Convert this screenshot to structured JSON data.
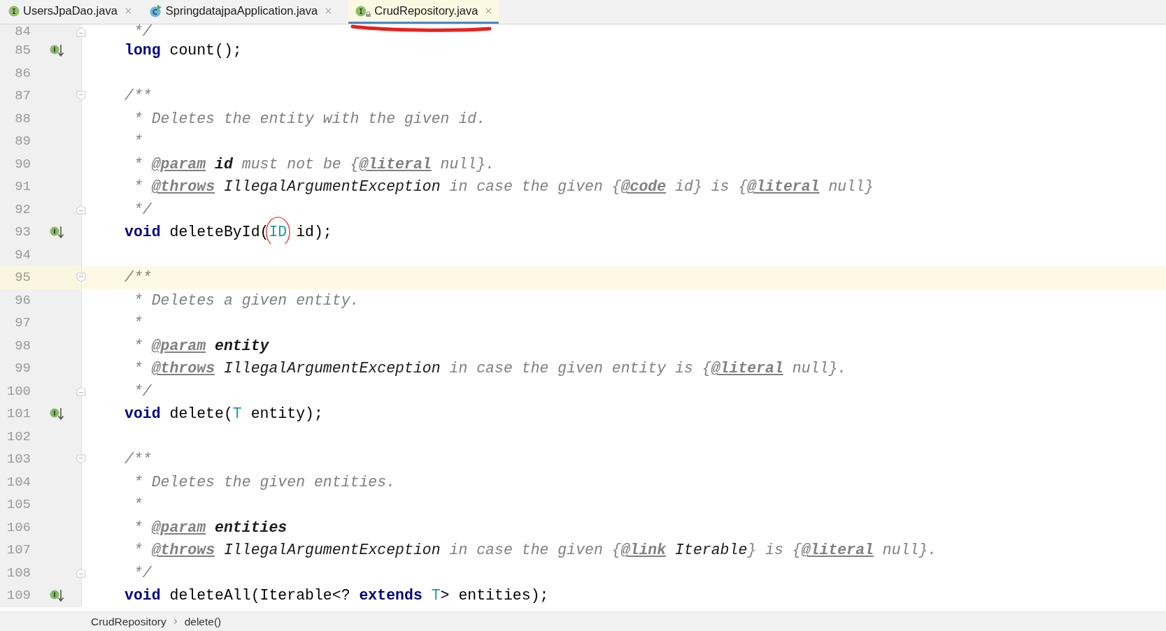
{
  "tabs": [
    {
      "label": "UsersJpaDao.java",
      "kind": "interface",
      "selected": false,
      "annotated": false
    },
    {
      "label": "SpringdatajpaApplication.java",
      "kind": "runnable-class",
      "selected": false,
      "annotated": false
    },
    {
      "label": "CrudRepository.java",
      "kind": "locked-interface",
      "selected": true,
      "annotated": true
    }
  ],
  "editor": {
    "lines": [
      {
        "number": "84",
        "kind": "fold-end",
        "current": false,
        "tokens": [
          {
            "kind": "comment",
            "text": " */"
          }
        ]
      },
      {
        "number": "85",
        "kind": "implemented",
        "current": false,
        "tokens": [
          {
            "kind": "keyword",
            "text": "long"
          },
          {
            "kind": "plain",
            "text": " count();"
          }
        ]
      },
      {
        "number": "86",
        "kind": "plain",
        "current": false
      },
      {
        "number": "87",
        "kind": "fold-start",
        "current": false,
        "tokens": [
          {
            "kind": "comment",
            "text": "/**"
          }
        ]
      },
      {
        "number": "88",
        "kind": "plain",
        "current": false,
        "tokens": [
          {
            "kind": "comment",
            "text": " * Deletes the entity with the given id."
          }
        ]
      },
      {
        "number": "89",
        "kind": "plain",
        "current": false,
        "tokens": [
          {
            "kind": "comment",
            "text": " *"
          }
        ]
      },
      {
        "number": "90",
        "kind": "plain",
        "current": false,
        "tokens": [
          {
            "kind": "comment",
            "text": " * "
          },
          {
            "kind": "tag",
            "text": "@param"
          },
          {
            "kind": "param-name",
            "text": " id"
          },
          {
            "kind": "comment",
            "text": " must not be {"
          },
          {
            "kind": "tag",
            "text": "@literal"
          },
          {
            "kind": "comment",
            "text": " null}."
          }
        ]
      },
      {
        "number": "91",
        "kind": "plain",
        "current": false,
        "tokens": [
          {
            "kind": "comment",
            "text": " * "
          },
          {
            "kind": "tag",
            "text": "@throws"
          },
          {
            "kind": "reference",
            "text": " IllegalArgumentException"
          },
          {
            "kind": "comment",
            "text": " in case the given {"
          },
          {
            "kind": "tag",
            "text": "@code"
          },
          {
            "kind": "comment",
            "text": " id} is {"
          },
          {
            "kind": "tag",
            "text": "@literal"
          },
          {
            "kind": "comment",
            "text": " null}"
          }
        ]
      },
      {
        "number": "92",
        "kind": "fold-end",
        "current": false,
        "tokens": [
          {
            "kind": "comment",
            "text": " */"
          }
        ]
      },
      {
        "number": "93",
        "kind": "implemented",
        "current": false,
        "tokens": [
          {
            "kind": "keyword",
            "text": "void"
          },
          {
            "kind": "plain",
            "text": " deleteById("
          },
          {
            "kind": "type-param",
            "text": "ID",
            "circled": true
          },
          {
            "kind": "plain",
            "text": " id);"
          }
        ]
      },
      {
        "number": "94",
        "kind": "plain",
        "current": false
      },
      {
        "number": "95",
        "kind": "fold-start",
        "current": true,
        "tokens": [
          {
            "kind": "comment",
            "text": "/**"
          }
        ]
      },
      {
        "number": "96",
        "kind": "plain",
        "current": false,
        "tokens": [
          {
            "kind": "comment",
            "text": " * Deletes a given entity."
          }
        ]
      },
      {
        "number": "97",
        "kind": "plain",
        "current": false,
        "tokens": [
          {
            "kind": "comment",
            "text": " *"
          }
        ]
      },
      {
        "number": "98",
        "kind": "plain",
        "current": false,
        "tokens": [
          {
            "kind": "comment",
            "text": " * "
          },
          {
            "kind": "tag",
            "text": "@param"
          },
          {
            "kind": "param-name",
            "text": " entity"
          }
        ]
      },
      {
        "number": "99",
        "kind": "plain",
        "current": false,
        "tokens": [
          {
            "kind": "comment",
            "text": " * "
          },
          {
            "kind": "tag",
            "text": "@throws"
          },
          {
            "kind": "reference",
            "text": " IllegalArgumentException"
          },
          {
            "kind": "comment",
            "text": " in case the given entity is {"
          },
          {
            "kind": "tag",
            "text": "@literal"
          },
          {
            "kind": "comment",
            "text": " null}."
          }
        ]
      },
      {
        "number": "100",
        "kind": "fold-end",
        "current": false,
        "tokens": [
          {
            "kind": "comment",
            "text": " */"
          }
        ]
      },
      {
        "number": "101",
        "kind": "implemented",
        "current": false,
        "tokens": [
          {
            "kind": "keyword",
            "text": "void"
          },
          {
            "kind": "plain",
            "text": " delete("
          },
          {
            "kind": "type-param",
            "text": "T"
          },
          {
            "kind": "plain",
            "text": " entity);"
          }
        ]
      },
      {
        "number": "102",
        "kind": "plain",
        "current": false
      },
      {
        "number": "103",
        "kind": "fold-start",
        "current": false,
        "tokens": [
          {
            "kind": "comment",
            "text": "/**"
          }
        ]
      },
      {
        "number": "104",
        "kind": "plain",
        "current": false,
        "tokens": [
          {
            "kind": "comment",
            "text": " * Deletes the given entities."
          }
        ]
      },
      {
        "number": "105",
        "kind": "plain",
        "current": false,
        "tokens": [
          {
            "kind": "comment",
            "text": " *"
          }
        ]
      },
      {
        "number": "106",
        "kind": "plain",
        "current": false,
        "tokens": [
          {
            "kind": "comment",
            "text": " * "
          },
          {
            "kind": "tag",
            "text": "@param"
          },
          {
            "kind": "param-name",
            "text": " entities"
          }
        ]
      },
      {
        "number": "107",
        "kind": "plain",
        "current": false,
        "tokens": [
          {
            "kind": "comment",
            "text": " * "
          },
          {
            "kind": "tag",
            "text": "@throws"
          },
          {
            "kind": "reference",
            "text": " IllegalArgumentException"
          },
          {
            "kind": "comment",
            "text": " in case the given {"
          },
          {
            "kind": "tag",
            "text": "@link"
          },
          {
            "kind": "reference",
            "text": " Iterable"
          },
          {
            "kind": "comment",
            "text": "} is {"
          },
          {
            "kind": "tag",
            "text": "@literal"
          },
          {
            "kind": "comment",
            "text": " null}."
          }
        ]
      },
      {
        "number": "108",
        "kind": "fold-end",
        "current": false,
        "tokens": [
          {
            "kind": "comment",
            "text": " */"
          }
        ]
      },
      {
        "number": "109",
        "kind": "implemented",
        "current": false,
        "tokens": [
          {
            "kind": "keyword",
            "text": "void"
          },
          {
            "kind": "plain",
            "text": " deleteAll(Iterable<? "
          },
          {
            "kind": "keyword",
            "text": "extends"
          },
          {
            "kind": "type-param",
            "text": " T"
          },
          {
            "kind": "plain",
            "text": "> entities);"
          }
        ]
      }
    ]
  },
  "breadcrumb": [
    "CrudRepository",
    "delete()"
  ]
}
